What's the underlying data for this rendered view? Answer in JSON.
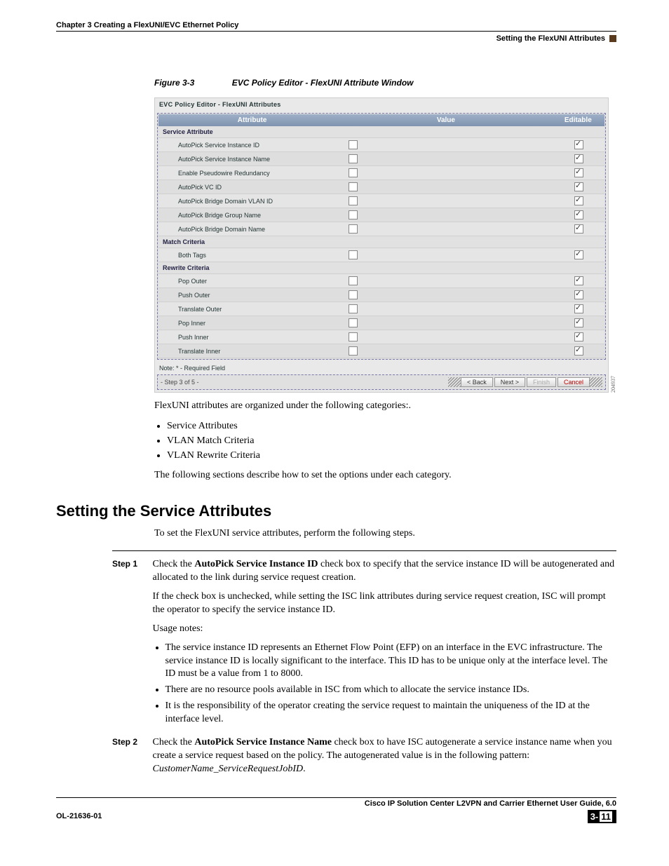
{
  "header": {
    "chapter_line": "Chapter 3    Creating a FlexUNI/EVC Ethernet Policy",
    "section_line": "Setting the FlexUNI Attributes"
  },
  "figure": {
    "number": "Figure 3-3",
    "title": "EVC Policy Editor - FlexUNI Attribute Window"
  },
  "editor": {
    "title": "EVC Policy Editor - FlexUNI Attributes",
    "columns": {
      "attr": "Attribute",
      "value": "Value",
      "editable": "Editable"
    },
    "groups": [
      {
        "label": "Service Attribute",
        "rows": [
          {
            "attr": "AutoPick Service Instance ID"
          },
          {
            "attr": "AutoPick Service Instance Name"
          },
          {
            "attr": "Enable Pseudowire Redundancy"
          },
          {
            "attr": "AutoPick VC ID"
          },
          {
            "attr": "AutoPick Bridge Domain VLAN ID"
          },
          {
            "attr": "AutoPick Bridge Group Name"
          },
          {
            "attr": "AutoPick Bridge Domain Name"
          }
        ]
      },
      {
        "label": "Match Criteria",
        "rows": [
          {
            "attr": "Both Tags"
          }
        ]
      },
      {
        "label": "Rewrite Criteria",
        "rows": [
          {
            "attr": "Pop Outer"
          },
          {
            "attr": "Push Outer"
          },
          {
            "attr": "Translate Outer"
          },
          {
            "attr": "Pop Inner"
          },
          {
            "attr": "Push Inner"
          },
          {
            "attr": "Translate Inner"
          }
        ]
      }
    ],
    "note": "Note: * - Required Field",
    "step_indicator": "- Step 3 of 5 -",
    "buttons": {
      "back": "< Back",
      "next": "Next >",
      "finish": "Finish",
      "cancel": "Cancel"
    },
    "side_number": "204937"
  },
  "body": {
    "para1": "FlexUNI attributes are organized under the following categories:.",
    "cat1": "Service Attributes",
    "cat2": "VLAN Match Criteria",
    "cat3": "VLAN Rewrite Criteria",
    "para2": "The following sections describe how to set the options under each category."
  },
  "section_heading": "Setting the Service Attributes",
  "section_intro": "To set the FlexUNI service attributes, perform the following steps.",
  "steps": {
    "s1": {
      "label": "Step 1",
      "run_pre": "Check the ",
      "bold": "AutoPick Service Instance ID",
      "run_post": " check box to specify that the service instance ID will be autogenerated and allocated to the link during service request creation.",
      "p2": "If the check box is unchecked, while setting the ISC link attributes during service request creation, ISC will prompt the operator to specify the service instance ID.",
      "p3": "Usage notes:",
      "b1": "The service instance ID represents an Ethernet Flow Point (EFP) on an interface in the EVC infrastructure. The service instance ID is locally significant to the interface. This ID has to be unique only at the interface level. The ID must be a value from 1 to 8000.",
      "b2": "There are no resource pools available in ISC from which to allocate the service instance IDs.",
      "b3": "It is the responsibility of the operator creating the service request to maintain the uniqueness of the ID at the interface level."
    },
    "s2": {
      "label": "Step 2",
      "run_pre": "Check the ",
      "bold": "AutoPick Service Instance Name",
      "run_post": " check box to have ISC autogenerate a service instance name when you create a service request based on the policy. The autogenerated value is in the following pattern: ",
      "italic": "CustomerName_ServiceRequestJobID",
      "tail": "."
    }
  },
  "footer": {
    "doc_title": "Cisco IP Solution Center L2VPN and Carrier Ethernet User Guide, 6.0",
    "doc_id": "OL-21636-01",
    "page_chapter": "3-",
    "page_number": "11"
  }
}
